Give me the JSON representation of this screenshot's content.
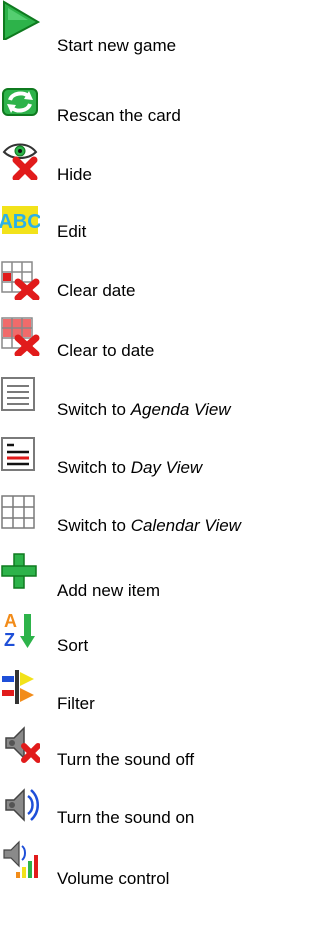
{
  "items": [
    {
      "icon": "play-icon",
      "label": "Start new game",
      "suffix": ""
    },
    {
      "icon": "refresh-icon",
      "label": "Rescan the card",
      "suffix": ""
    },
    {
      "icon": "eye-hide-icon",
      "label": "Hide",
      "suffix": ""
    },
    {
      "icon": "edit-abc-icon",
      "label": "Edit",
      "suffix": ""
    },
    {
      "icon": "calendar-clear-icon",
      "label": "Clear date",
      "suffix": ""
    },
    {
      "icon": "calendar-clear-red-icon",
      "label": "Clear to date",
      "suffix": ""
    },
    {
      "icon": "agenda-view-icon",
      "label": "Switch to ",
      "suffix": "Agenda View"
    },
    {
      "icon": "day-view-icon",
      "label": "Switch to ",
      "suffix": "Day View"
    },
    {
      "icon": "calendar-grid-icon",
      "label": "Switch to ",
      "suffix": "Calendar View"
    },
    {
      "icon": "plus-icon",
      "label": "Add new item",
      "suffix": ""
    },
    {
      "icon": "sort-az-icon",
      "label": "Sort",
      "suffix": ""
    },
    {
      "icon": "filter-icon",
      "label": "Filter",
      "suffix": ""
    },
    {
      "icon": "sound-off-icon",
      "label": "Turn the sound off",
      "suffix": ""
    },
    {
      "icon": "sound-on-icon",
      "label": "Turn the sound on",
      "suffix": ""
    },
    {
      "icon": "volume-control-icon",
      "label": "Volume control",
      "suffix": ""
    }
  ],
  "colors": {
    "green": "#2db34a",
    "red": "#e11b1b",
    "blue": "#1e4fd8",
    "yellow": "#f2e21a",
    "grey": "#7a7a7a"
  }
}
